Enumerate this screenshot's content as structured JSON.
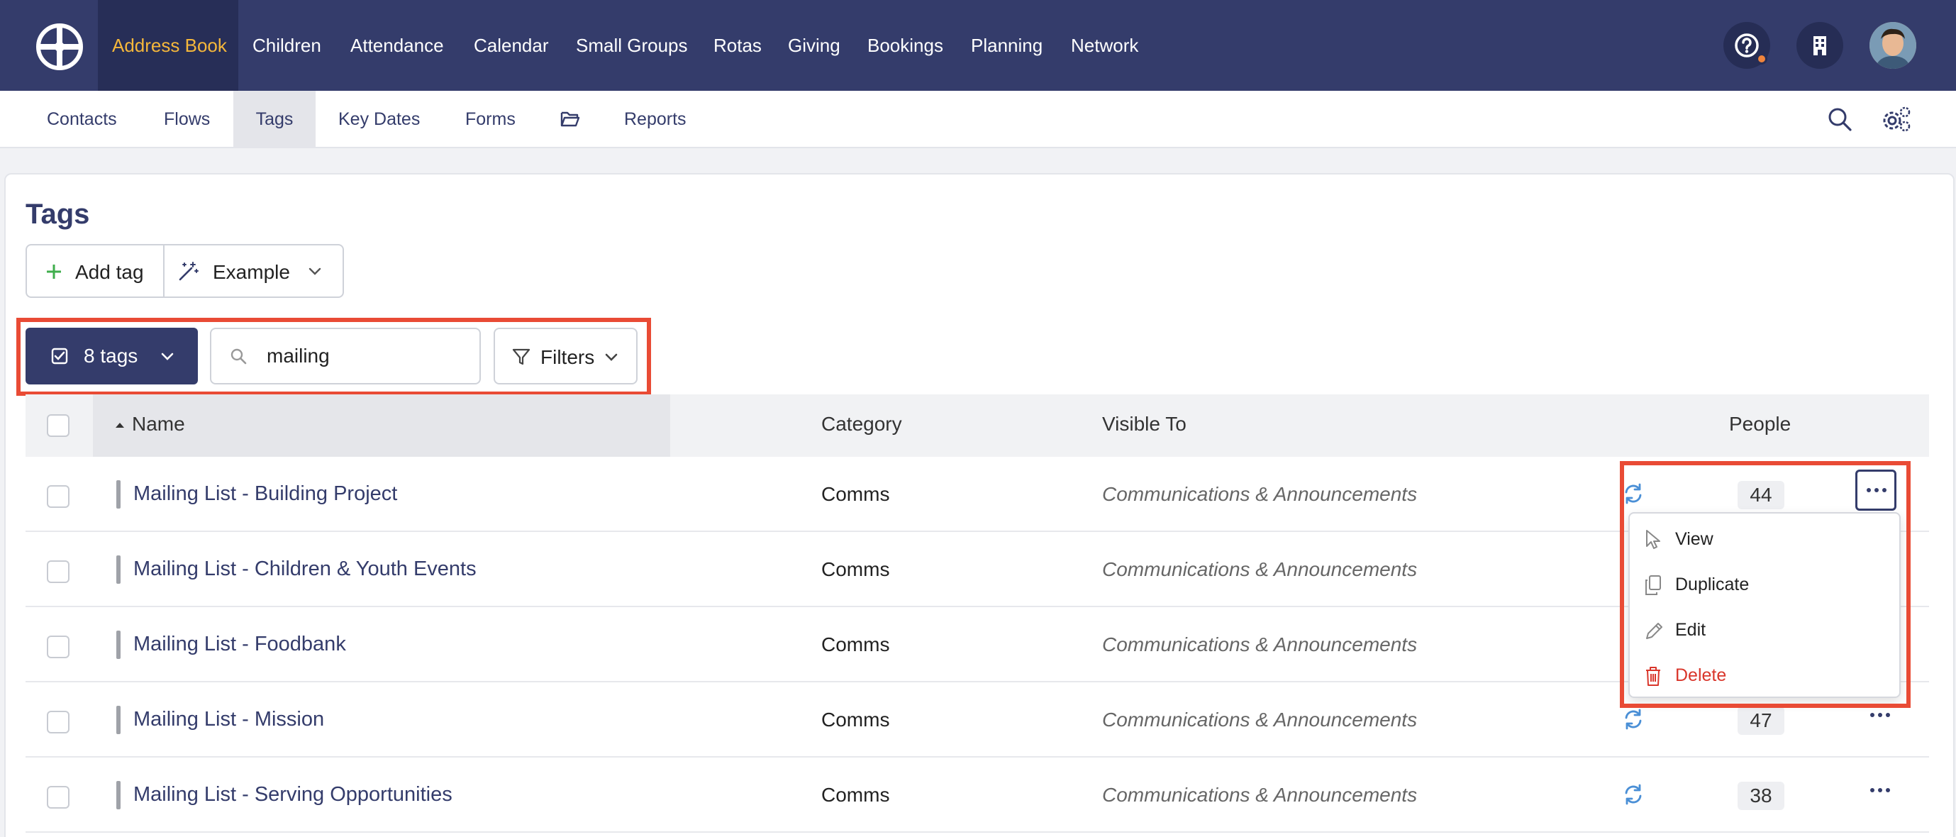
{
  "topnav": {
    "items": [
      {
        "label": "Address Book",
        "active": true
      },
      {
        "label": "Children"
      },
      {
        "label": "Attendance"
      },
      {
        "label": "Calendar"
      },
      {
        "label": "Small Groups"
      },
      {
        "label": "Rotas"
      },
      {
        "label": "Giving"
      },
      {
        "label": "Bookings"
      },
      {
        "label": "Planning"
      },
      {
        "label": "Network"
      }
    ],
    "icons": [
      "help-icon",
      "building-icon"
    ],
    "colors": {
      "bar": "#343c6b",
      "active_text": "#f5b73b",
      "notification": "#f0843c"
    }
  },
  "subnav": {
    "items": [
      {
        "label": "Contacts"
      },
      {
        "label": "Flows"
      },
      {
        "label": "Tags",
        "active": true
      },
      {
        "label": "Key Dates"
      },
      {
        "label": "Forms"
      },
      {
        "label": "Reports",
        "icon": "folder-open-icon"
      }
    ],
    "icons": [
      "search-icon",
      "settings-gears-icon"
    ]
  },
  "page": {
    "title": "Tags",
    "add_tag_label": "Add tag",
    "example_label": "Example"
  },
  "toolbar": {
    "selection_label": "8 tags",
    "search_value": "mailing",
    "filters_label": "Filters"
  },
  "table": {
    "columns": {
      "name": "Name",
      "category": "Category",
      "visible_to": "Visible To",
      "people": "People"
    },
    "sort": {
      "column": "Name",
      "direction": "ascending"
    },
    "rows": [
      {
        "name": "Mailing List - Building Project",
        "category": "Comms",
        "visible_to": "Communications & Announcements",
        "people": "44"
      },
      {
        "name": "Mailing List - Children & Youth Events",
        "category": "Comms",
        "visible_to": "Communications & Announcements",
        "people": ""
      },
      {
        "name": "Mailing List - Foodbank",
        "category": "Comms",
        "visible_to": "Communications & Announcements",
        "people": ""
      },
      {
        "name": "Mailing List - Mission",
        "category": "Comms",
        "visible_to": "Communications & Announcements",
        "people": "47"
      },
      {
        "name": "Mailing List - Serving Opportunities",
        "category": "Comms",
        "visible_to": "Communications & Announcements",
        "people": "38"
      }
    ]
  },
  "row_menu": {
    "items": [
      {
        "label": "View",
        "icon": "pointer-icon"
      },
      {
        "label": "Duplicate",
        "icon": "copy-icon"
      },
      {
        "label": "Edit",
        "icon": "pencil-icon"
      },
      {
        "label": "Delete",
        "icon": "trash-icon",
        "color": "#d9362b"
      }
    ]
  },
  "highlight_color": "#e94b35"
}
